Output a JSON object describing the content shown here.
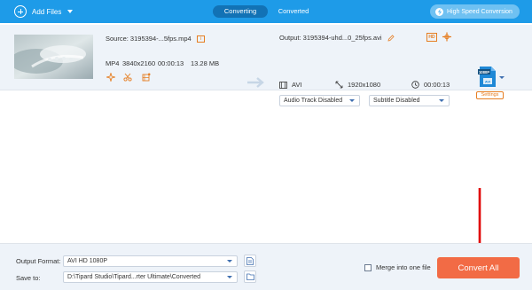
{
  "topbar": {
    "add_files_label": "Add Files",
    "tabs": [
      {
        "label": "Converting",
        "active": true
      },
      {
        "label": "Converted",
        "active": false
      }
    ],
    "high_speed_label": "High Speed Conversion"
  },
  "file": {
    "source_label": "Source: 3195394-...5fps.mp4",
    "format": "MP4",
    "resolution": "3840x2160",
    "duration": "00:00:13",
    "size": "13.28 MB",
    "output_label": "Output: 3195394-uhd...0_25fps.avi",
    "output_format": "AVI",
    "output_resolution": "1920x1080",
    "output_duration": "00:00:13",
    "audio_track": "Audio Track Disabled",
    "subtitle": "Subtitle Disabled",
    "settings_label": "Settings",
    "hd_badge": "HD"
  },
  "bottom": {
    "output_format_label": "Output Format:",
    "output_format_value": "AVI HD 1080P",
    "save_to_label": "Save to:",
    "save_to_value": "D:\\Tipard Studio\\Tipard...rter Ultimate\\Converted",
    "merge_label": "Merge into one file",
    "merge_checked": false,
    "convert_all_label": "Convert All"
  },
  "colors": {
    "topbar": "#1e9be8",
    "accent_orange": "#e67e22",
    "convert_button": "#f26b45",
    "row_background": "#eef3f9",
    "annotation_arrow": "#e00000"
  }
}
